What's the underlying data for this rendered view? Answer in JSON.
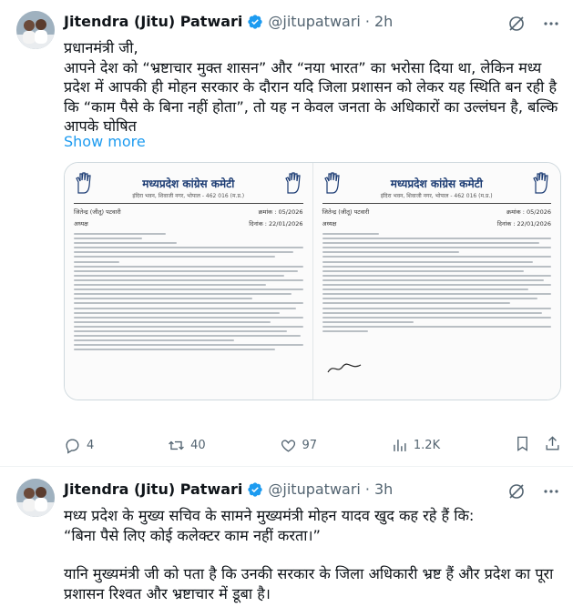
{
  "tweets": [
    {
      "author_name": "Jitendra (Jitu) Patwari",
      "handle": "@jitupatwari",
      "dot": "·",
      "time": "2h",
      "lines": [
        "प्रधानमंत्री जी,",
        "आपने देश को “भ्रष्टाचार मुक्त शासन” और “नया भारत” का भरोसा दिया था, लेकिन मध्य प्रदेश में आपकी ही मोहन सरकार के दौरान यदि जिला प्रशासन को लेकर यह स्थिति बन रही है कि “काम पैसे के बिना नहीं होता”, तो यह न केवल जनता के अधिकारों का उल्लंघन है, बल्कि आपके घोषित"
      ],
      "show_more": "Show more",
      "media": {
        "pages": [
          {
            "title": "मध्यप्रदेश कांग्रेस कमेटी",
            "address": "इंदिरा भवन, शिवाजी नगर, भोपाल - 462 016 (म.प्र.)",
            "sender": "जितेन्द्र (जीतू) पटवारी",
            "role": "अध्यक्ष",
            "ref_label": "क्रमांक",
            "ref": "05/2026",
            "date_label": "दिनांक",
            "date": "22/01/2026"
          },
          {
            "title": "मध्यप्रदेश कांग्रेस कमेटी",
            "address": "इंदिरा भवन, शिवाजी नगर, भोपाल - 462 016 (म.प्र.)",
            "sender": "जितेन्द्र (जीतू) पटवारी",
            "role": "अध्यक्ष",
            "ref_label": "क्रमांक",
            "ref": "05/2026",
            "date_label": "दिनांक",
            "date": "22/01/2026"
          }
        ]
      },
      "actions": {
        "replies": "4",
        "reposts": "40",
        "likes": "97",
        "views": "1.2K"
      }
    },
    {
      "author_name": "Jitendra (Jitu) Patwari",
      "handle": "@jitupatwari",
      "dot": "·",
      "time": "3h",
      "lines": [
        "मध्य प्रदेश के मुख्य सचिव के सामने मुख्यमंत्री मोहन यादव खुद कह रहे हैं कि:\n“बिना पैसे लिए कोई कलेक्टर काम नहीं करता।”",
        "यानि मुख्यमंत्री जी को पता है कि उनकी सरकार के जिला अधिकारी भ्रष्ट हैं और प्रदेश का पूरा प्रशासन रिश्वत और भ्रष्टाचार में डूबा है।"
      ]
    }
  ],
  "icons": {
    "verified": "verified-badge-icon",
    "grok": "grok-icon",
    "more": "more-icon",
    "reply": "reply-icon",
    "repost": "repost-icon",
    "like": "heart-icon",
    "views": "views-icon",
    "bookmark": "bookmark-icon",
    "share": "share-icon"
  },
  "colors": {
    "accent": "#1d9bf0",
    "text": "#0f1419",
    "muted": "#536471",
    "letterhead": "#1b3b73"
  }
}
